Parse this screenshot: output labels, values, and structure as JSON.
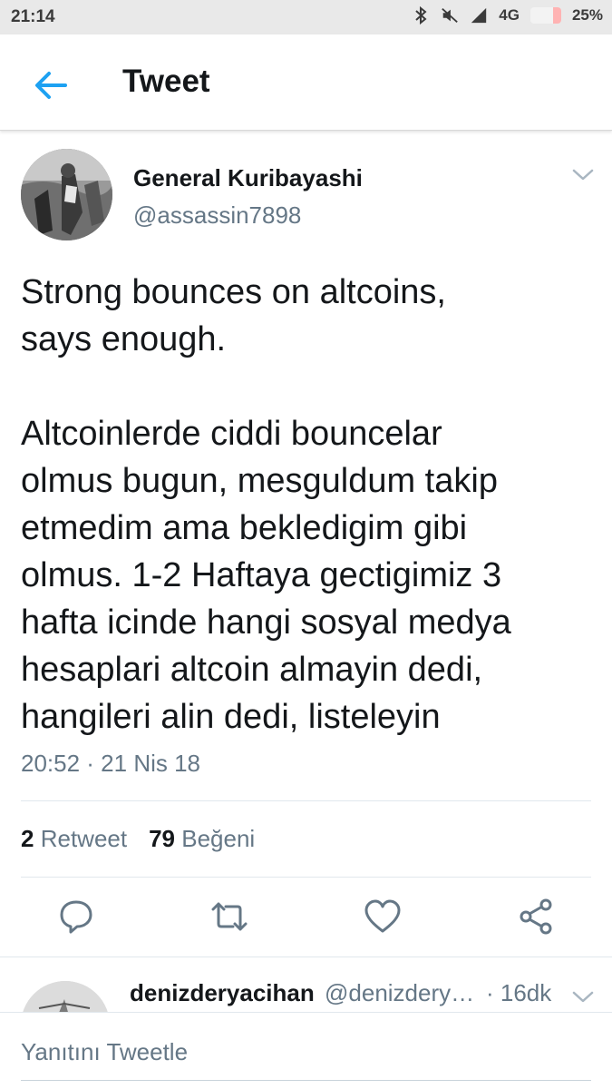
{
  "status_bar": {
    "time": "21:14",
    "network": "4G",
    "battery_percent": "25%",
    "battery_level": 0.25,
    "icons": [
      "bluetooth-icon",
      "mute-icon",
      "signal-icon",
      "battery-icon"
    ]
  },
  "header": {
    "title": "Tweet",
    "back_icon": "back-arrow-icon"
  },
  "tweet": {
    "author_name": "General Kuribayashi",
    "author_handle": "@assassin7898",
    "text_lines": [
      "Strong bounces on altcoins,",
      "says enough.",
      "",
      "Altcoinlerde ciddi bouncelar",
      "olmus bugun, mesguldum takip",
      "etmedim ama bekledigim gibi",
      "olmus. 1-2 Haftaya gectigimiz 3",
      "hafta icinde hangi sosyal medya",
      "hesaplari altcoin almayin dedi,",
      "hangileri alin dedi, listeleyin"
    ],
    "timestamp": "20:52 · 21 Nis 18",
    "retweet_count": "2",
    "retweet_label": "Retweet",
    "like_count": "79",
    "like_label": "Beğeni"
  },
  "actions": [
    "reply-icon",
    "retweet-icon",
    "like-icon",
    "share-icon"
  ],
  "reply_preview": {
    "name": "denizderyacihan",
    "handle": "@denizdery…",
    "time": "· 16dk"
  },
  "composer": {
    "placeholder": "Yanıtını Tweetle"
  },
  "colors": {
    "accent": "#1da1f2",
    "text": "#14171a",
    "muted": "#657786",
    "status_bar_bg": "#e9e9e9"
  }
}
